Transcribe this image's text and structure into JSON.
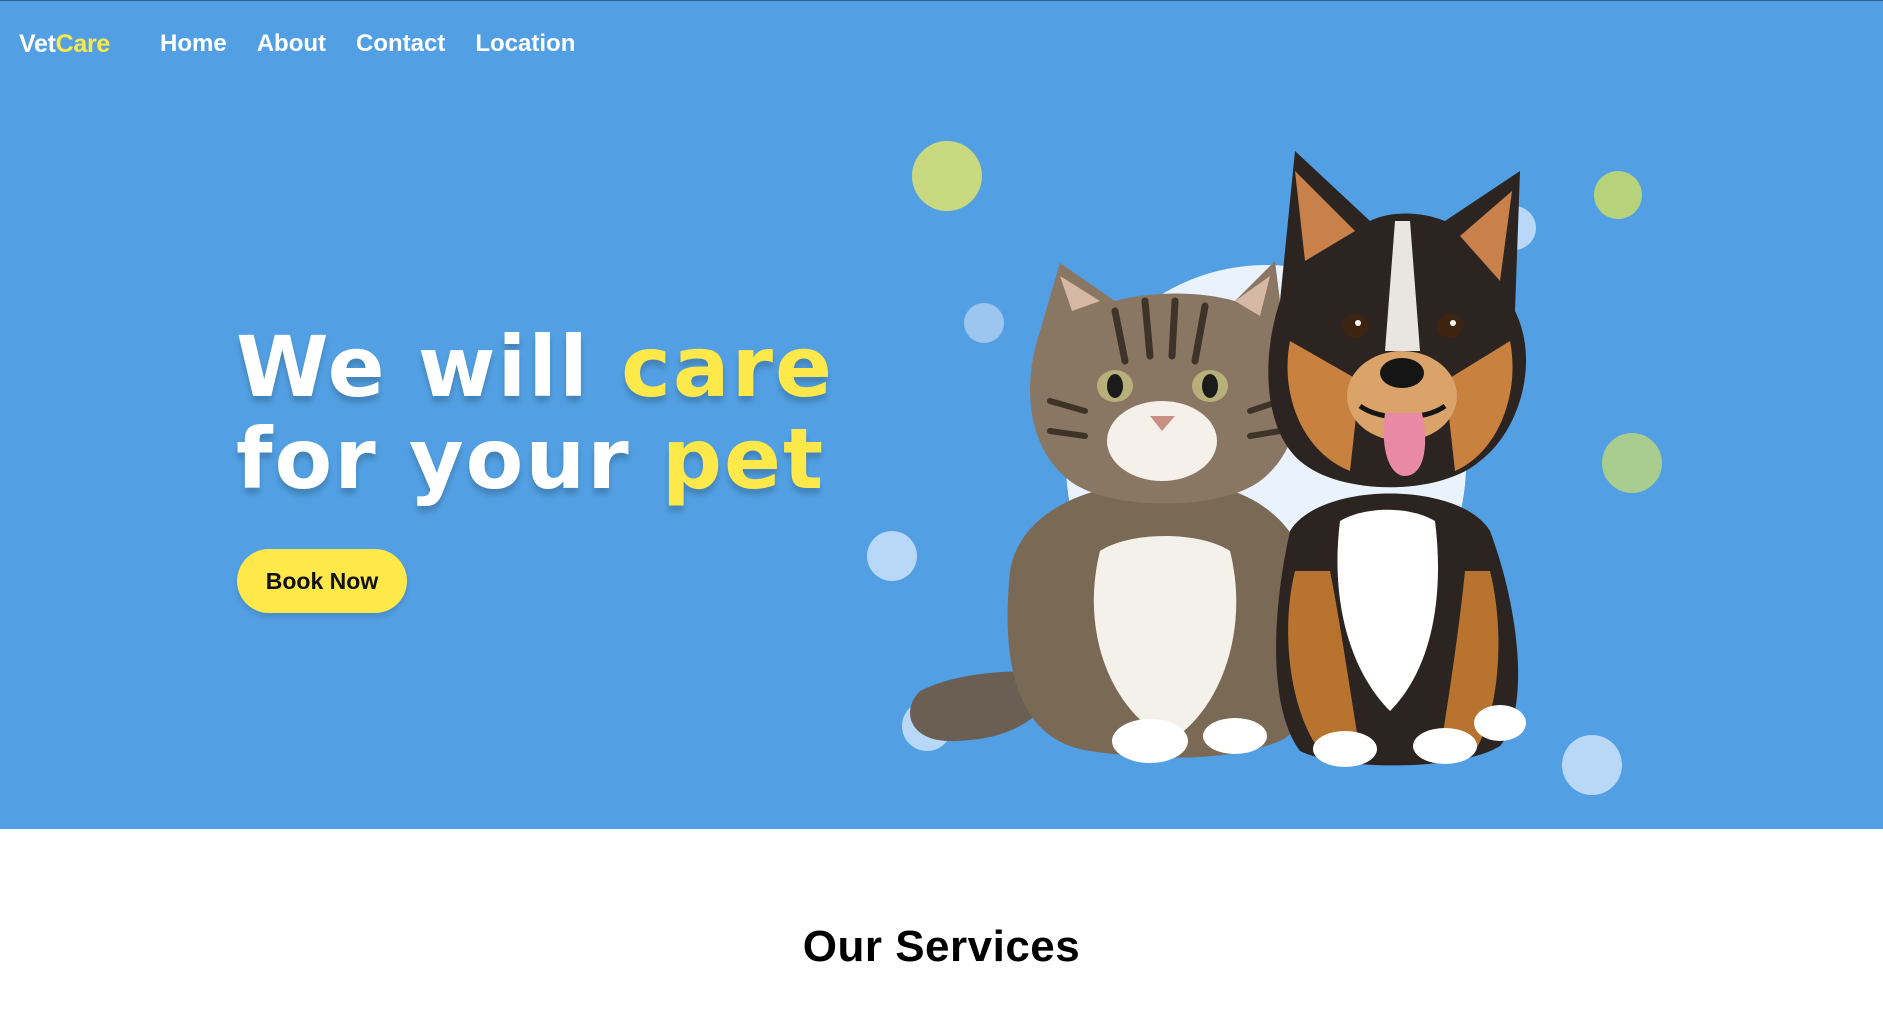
{
  "nav": {
    "logo_part1": "Vet",
    "logo_part2": "Care",
    "links": [
      "Home",
      "About",
      "Contact",
      "Location"
    ]
  },
  "hero": {
    "headline_line1_a": "We will ",
    "headline_line1_b": "care",
    "headline_line2_a": "for your ",
    "headline_line2_b": "pet",
    "cta_label": "Book Now",
    "image": "kitten-and-puppy-illustration"
  },
  "services": {
    "title": "Our Services"
  },
  "colors": {
    "hero_bg": "#52a0e3",
    "accent_yellow": "#ffe84a",
    "green_dot": "#c9d97f",
    "light_dot": "#b9d8f7"
  }
}
